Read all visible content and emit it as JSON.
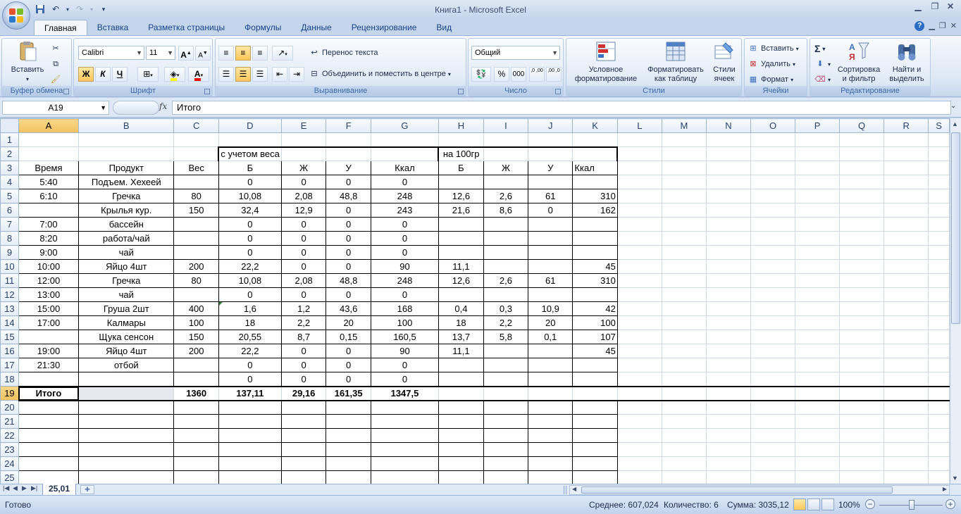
{
  "app": {
    "window_title": "Книга1 - Microsoft Excel",
    "window_controls": [
      "minimize-icon",
      "maximize-icon",
      "close-icon"
    ]
  },
  "ribbon": {
    "tabs": [
      {
        "label": "Главная",
        "active": true
      },
      {
        "label": "Вставка"
      },
      {
        "label": "Разметка страницы"
      },
      {
        "label": "Формулы"
      },
      {
        "label": "Данные"
      },
      {
        "label": "Рецензирование"
      },
      {
        "label": "Вид"
      }
    ],
    "clipboard": {
      "paste": "Вставить",
      "group": "Буфер обмена"
    },
    "font": {
      "name": "Calibri",
      "size": "11",
      "bold": "Ж",
      "italic": "К",
      "underline": "Ч",
      "grow": "A",
      "shrink": "A",
      "fill_color": "#ffff00",
      "font_color": "#ff0000",
      "group": "Шрифт"
    },
    "alignment": {
      "wrap": "Перенос текста",
      "merge": "Объединить и поместить в центре",
      "group": "Выравнивание"
    },
    "number": {
      "format": "Общий",
      "percent": "%",
      "thousands": "000",
      "inc_decimal": ",0 ,00",
      "dec_decimal": ",00 ,0",
      "group": "Число"
    },
    "styles": {
      "conditional_1": "Условное",
      "conditional_2": "форматирование",
      "table_1": "Форматировать",
      "table_2": "как таблицу",
      "cell_1": "Стили",
      "cell_2": "ячеек",
      "group": "Стили"
    },
    "cells": {
      "insert": "Вставить",
      "delete": "Удалить",
      "format": "Формат",
      "group": "Ячейки"
    },
    "editing": {
      "sum": "Σ",
      "sort_1": "Сортировка",
      "sort_2": "и фильтр",
      "find_1": "Найти и",
      "find_2": "выделить",
      "group": "Редактирование"
    }
  },
  "formula_bar": {
    "name_box": "A19",
    "fx": "fx",
    "value": "Итого"
  },
  "grid": {
    "selected_cell": "A19",
    "columns": [
      "A",
      "B",
      "C",
      "D",
      "E",
      "F",
      "G",
      "H",
      "I",
      "J",
      "K",
      "L",
      "M",
      "N",
      "O",
      "P",
      "Q",
      "R",
      "S"
    ],
    "rows": [
      [
        "",
        "",
        "",
        "",
        "",
        "",
        "",
        "",
        "",
        "",
        ""
      ],
      [
        "",
        "",
        "",
        "с учетом веса",
        "",
        "",
        "",
        "на 100гр",
        "",
        "",
        ""
      ],
      [
        "Время",
        "Продукт",
        "Вес",
        "Б",
        "Ж",
        "У",
        "Ккал",
        "Б",
        "Ж",
        "У",
        "Ккал"
      ],
      [
        "5:40",
        "Подъем. Хехеей",
        "",
        "0",
        "0",
        "0",
        "0",
        "",
        "",
        "",
        ""
      ],
      [
        "6:10",
        "Гречка",
        "80",
        "10,08",
        "2,08",
        "48,8",
        "248",
        "12,6",
        "2,6",
        "61",
        "310"
      ],
      [
        "",
        "Крылья кур.",
        "150",
        "32,4",
        "12,9",
        "0",
        "243",
        "21,6",
        "8,6",
        "0",
        "162"
      ],
      [
        "7:00",
        "бассейн",
        "",
        "0",
        "0",
        "0",
        "0",
        "",
        "",
        "",
        ""
      ],
      [
        "8:20",
        "работа/чай",
        "",
        "0",
        "0",
        "0",
        "0",
        "",
        "",
        "",
        ""
      ],
      [
        "9:00",
        "чай",
        "",
        "0",
        "0",
        "0",
        "0",
        "",
        "",
        "",
        ""
      ],
      [
        "10:00",
        "Яйцо 4шт",
        "200",
        "22,2",
        "0",
        "0",
        "90",
        "11,1",
        "",
        "",
        "45"
      ],
      [
        "12:00",
        "Гречка",
        "80",
        "10,08",
        "2,08",
        "48,8",
        "248",
        "12,6",
        "2,6",
        "61",
        "310"
      ],
      [
        "13:00",
        "чай",
        "",
        "0",
        "0",
        "0",
        "0",
        "",
        "",
        "",
        ""
      ],
      [
        "15:00",
        "Груша 2шт",
        "400",
        "1,6",
        "1,2",
        "43,6",
        "168",
        "0,4",
        "0,3",
        "10,9",
        "42"
      ],
      [
        "17:00",
        "Калмары",
        "100",
        "18",
        "2,2",
        "20",
        "100",
        "18",
        "2,2",
        "20",
        "100"
      ],
      [
        "",
        "Щука сенсон",
        "150",
        "20,55",
        "8,7",
        "0,15",
        "160,5",
        "13,7",
        "5,8",
        "0,1",
        "107"
      ],
      [
        "19:00",
        "Яйцо 4шт",
        "200",
        "22,2",
        "0",
        "0",
        "90",
        "11,1",
        "",
        "",
        "45"
      ],
      [
        "21:30",
        "отбой",
        "",
        "0",
        "0",
        "0",
        "0",
        "",
        "",
        "",
        ""
      ],
      [
        "",
        "",
        "",
        "0",
        "0",
        "0",
        "0",
        "",
        "",
        "",
        ""
      ],
      [
        "Итого",
        "",
        "1360",
        "137,11",
        "29,16",
        "161,35",
        "1347,5",
        "",
        "",
        "",
        ""
      ],
      [
        "",
        "",
        "",
        "",
        "",
        "",
        "",
        "",
        "",
        "",
        ""
      ],
      [
        "",
        "",
        "",
        "",
        "",
        "",
        "",
        "",
        "",
        "",
        ""
      ],
      [
        "",
        "",
        "",
        "",
        "",
        "",
        "",
        "",
        "",
        "",
        ""
      ],
      [
        "",
        "",
        "",
        "",
        "",
        "",
        "",
        "",
        "",
        "",
        ""
      ],
      [
        "",
        "",
        "",
        "",
        "",
        "",
        "",
        "",
        "",
        "",
        ""
      ],
      [
        "",
        "",
        "",
        "",
        "",
        "",
        "",
        "",
        "",
        "",
        ""
      ]
    ]
  },
  "sheet_tabs": [
    {
      "label": "25,01",
      "active": true
    }
  ],
  "status": {
    "ready": "Готово",
    "average": "Среднее: 607,024",
    "count": "Количество: 6",
    "sum": "Сумма: 3035,12",
    "zoom": "100%"
  }
}
